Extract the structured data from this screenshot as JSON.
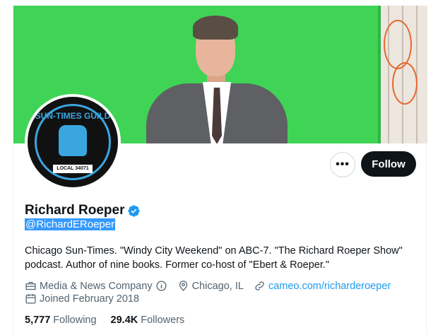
{
  "profile": {
    "name": "Richard Roeper",
    "handle": "@RichardERoeper",
    "bio": "Chicago Sun-Times. \"Windy City Weekend\" on ABC-7.  \"The Richard Roeper Show\" podcast. Author of nine books. Former co-host of \"Ebert & Roeper.\"",
    "category": "Media & News Company",
    "location": "Chicago, IL",
    "website": "cameo.com/richarderoeper",
    "joined": "Joined February 2018",
    "following_count": "5,777",
    "following_label": "Following",
    "followers_count": "29.4K",
    "followers_label": "Followers"
  },
  "avatar": {
    "top_text": "SUN-TIMES GUILD",
    "bottom_text": "LOCAL 34071"
  },
  "actions": {
    "more_label": "•••",
    "follow_label": "Follow"
  },
  "colors": {
    "accent": "#1d9bf0",
    "banner_green": "#3fd455",
    "follow_bg": "#0f1419"
  },
  "icons": [
    "verified-badge-icon",
    "briefcase-icon",
    "info-icon",
    "location-pin-icon",
    "link-icon",
    "calendar-icon"
  ]
}
